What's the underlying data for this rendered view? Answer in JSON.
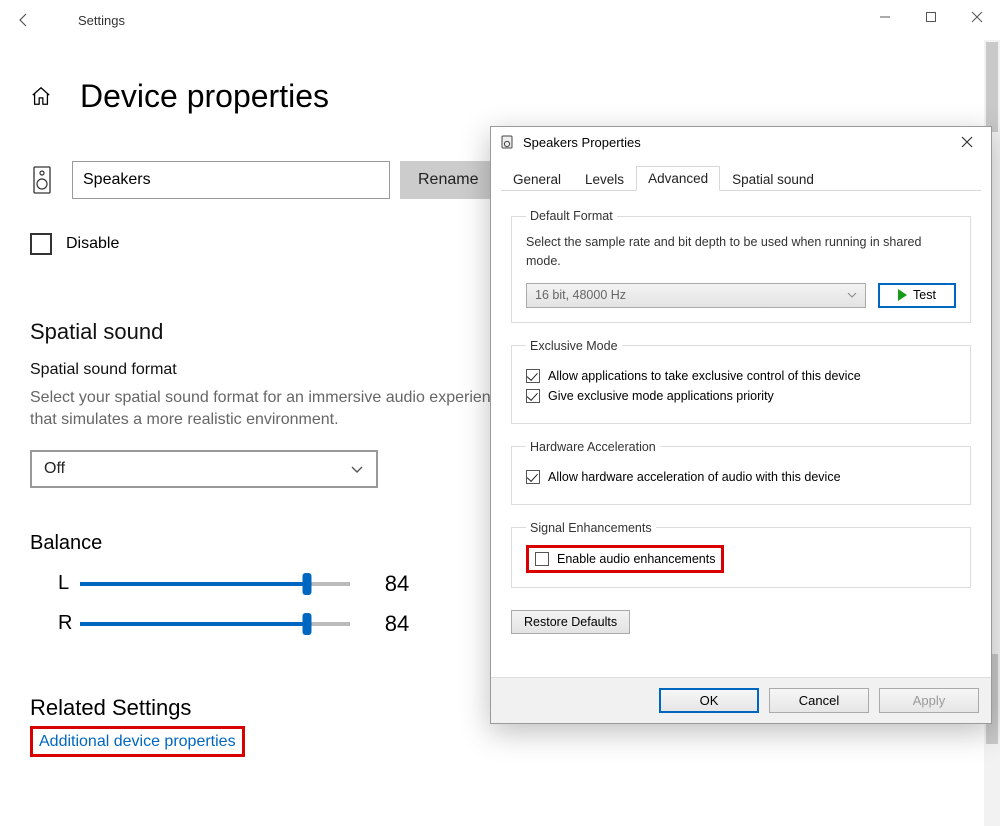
{
  "settings": {
    "title": "Settings",
    "page_title": "Device properties",
    "device_name": "Speakers",
    "rename_label": "Rename",
    "disable_label": "Disable",
    "spatial_heading": "Spatial sound",
    "spatial_sub": "Spatial sound format",
    "spatial_hint": "Select your spatial sound format for an immersive audio experience that simulates a more realistic environment.",
    "spatial_value": "Off",
    "balance_heading": "Balance",
    "balance": {
      "left_label": "L",
      "left_value": "84",
      "right_label": "R",
      "right_value": "84"
    },
    "related_heading": "Related Settings",
    "related_link": "Additional device properties"
  },
  "dialog": {
    "title": "Speakers Properties",
    "tabs": {
      "general": "General",
      "levels": "Levels",
      "advanced": "Advanced",
      "spatial": "Spatial sound"
    },
    "default_format": {
      "legend": "Default Format",
      "desc": "Select the sample rate and bit depth to be used when running in shared mode.",
      "value": "16 bit, 48000 Hz",
      "test_label": "Test"
    },
    "exclusive": {
      "legend": "Exclusive Mode",
      "opt1": "Allow applications to take exclusive control of this device",
      "opt2": "Give exclusive mode applications priority"
    },
    "hw": {
      "legend": "Hardware Acceleration",
      "opt": "Allow hardware acceleration of audio with this device"
    },
    "signal": {
      "legend": "Signal Enhancements",
      "opt": "Enable audio enhancements"
    },
    "restore_label": "Restore Defaults",
    "ok_label": "OK",
    "cancel_label": "Cancel",
    "apply_label": "Apply"
  }
}
